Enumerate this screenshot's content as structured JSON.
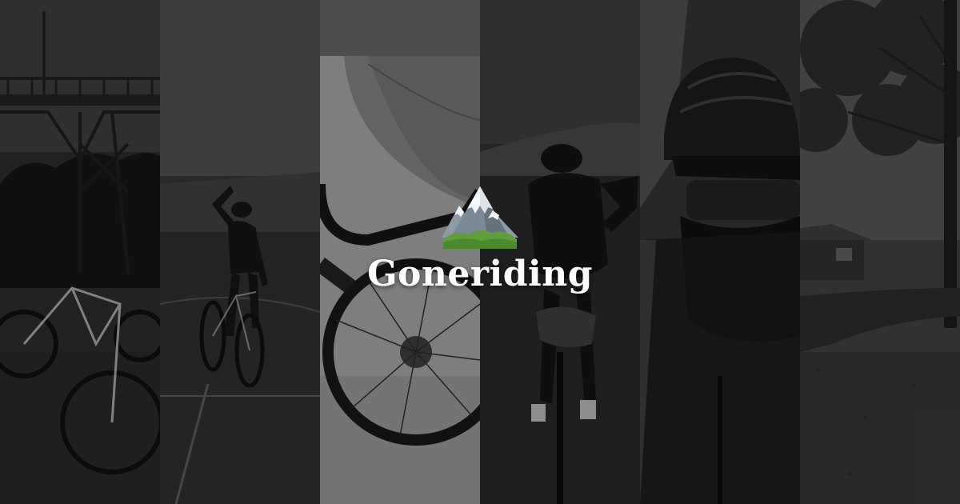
{
  "brand": {
    "title": "Goneriding",
    "logo_icon": "snow-capped-mountain-icon"
  },
  "photo_strips": [
    {
      "subject": "bridge-bikes-photo"
    },
    {
      "subject": "rider-celebrating-photo"
    },
    {
      "subject": "gravel-road-wheel-photo"
    },
    {
      "subject": "rider-from-behind-photo"
    },
    {
      "subject": "rider-selfie-photo"
    },
    {
      "subject": "park-path-tree-photo"
    }
  ],
  "colors": {
    "background": "#1a1a1a",
    "title": "#ffffff",
    "mountain_snow": "#f4f6f8",
    "mountain_rock": "#7a8a96",
    "mountain_grass": "#5f9e3a"
  }
}
